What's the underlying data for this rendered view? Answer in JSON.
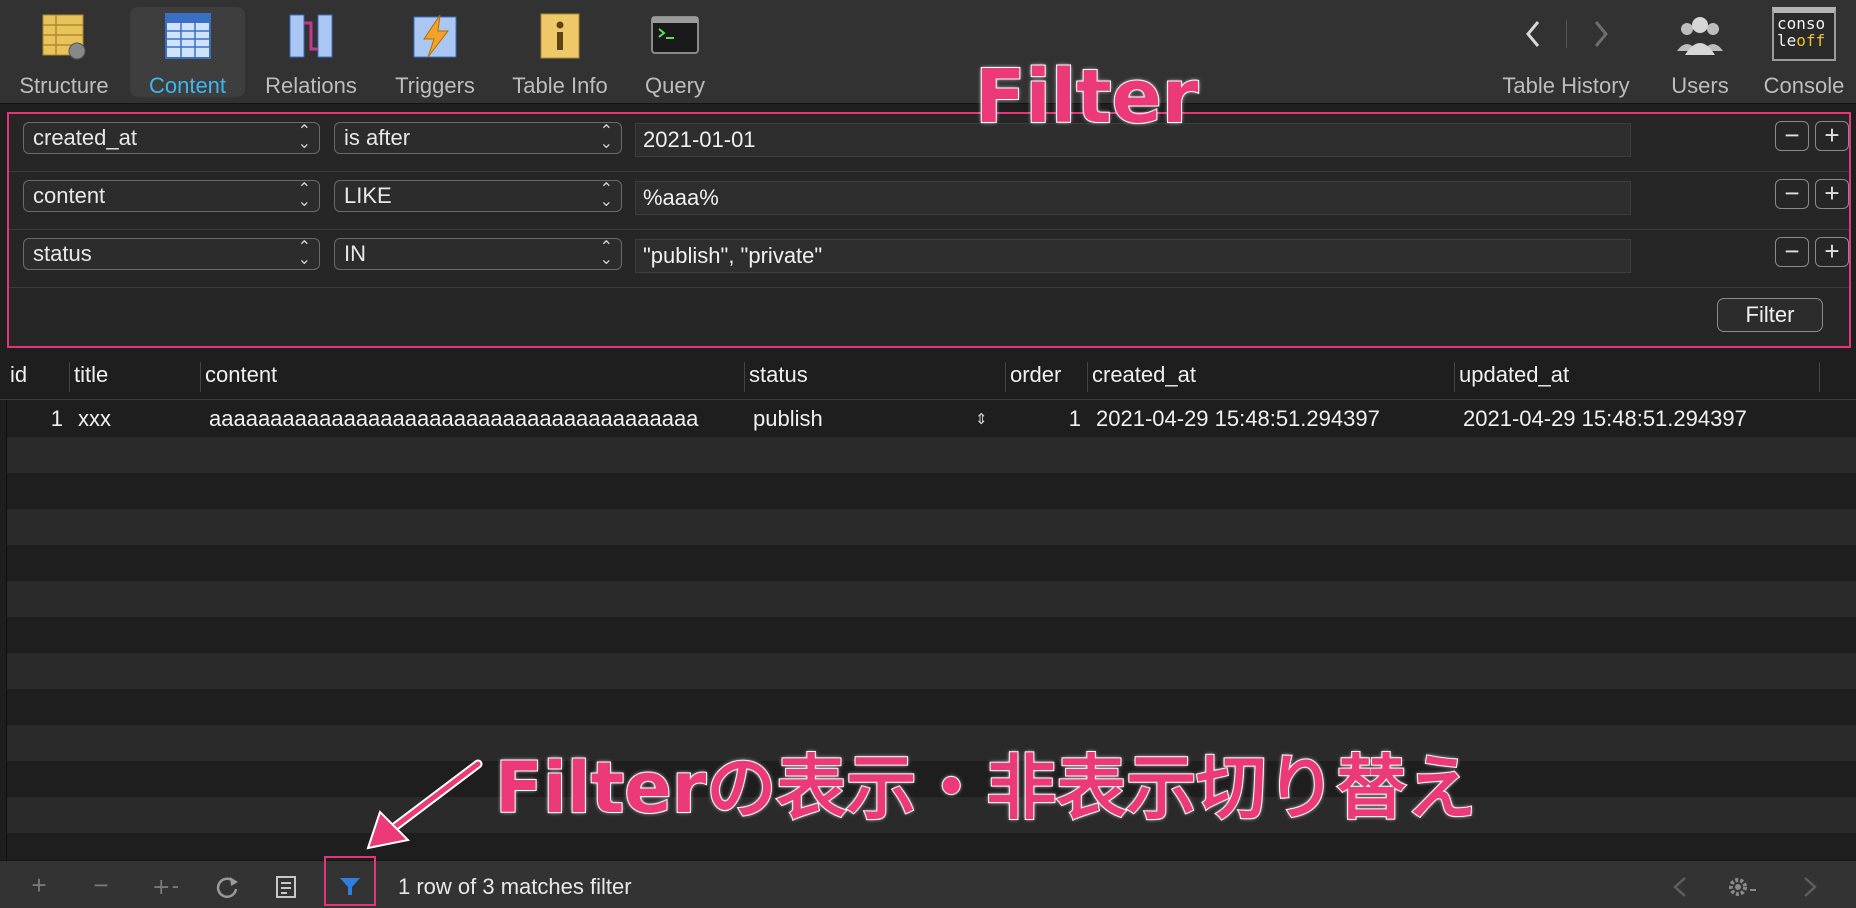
{
  "toolbar": {
    "left_items": [
      {
        "label": "Structure"
      },
      {
        "label": "Content"
      },
      {
        "label": "Relations"
      },
      {
        "label": "Triggers"
      },
      {
        "label": "Table Info"
      },
      {
        "label": "Query"
      }
    ],
    "right_items": [
      {
        "label": "Table History"
      },
      {
        "label": "Users"
      },
      {
        "label": "Console"
      }
    ],
    "active": "Content",
    "active_color": "#3eb6ef",
    "console_icon_text_1": "conso",
    "console_icon_text_2": "le",
    "console_icon_text_3": "off"
  },
  "annotations": {
    "filter_heading": "Filter",
    "toggle_caption": "Filterの表示・非表示切り替え",
    "accent_color": "#e4357a"
  },
  "filters": [
    {
      "column": "created_at",
      "operator": "is after",
      "value": "2021-01-01"
    },
    {
      "column": "content",
      "operator": "LIKE",
      "value": "%aaa%"
    },
    {
      "column": "status",
      "operator": "IN",
      "value": "\"publish\", \"private\""
    }
  ],
  "filter_button": "Filter",
  "table": {
    "columns": [
      "id",
      "title",
      "content",
      "status",
      "order",
      "created_at",
      "updated_at"
    ],
    "rows": [
      {
        "id": "1",
        "title": "xxx",
        "content": "aaaaaaaaaaaaaaaaaaaaaaaaaaaaaaaaaaaaaaaa",
        "status": "publish",
        "order": "1",
        "created_at": "2021-04-29 15:48:51.294397",
        "updated_at": "2021-04-29 15:48:51.294397"
      }
    ]
  },
  "footer": {
    "status_text": "1 row of 3 matches filter",
    "filter_toggle_color": "#2f7fe0"
  }
}
